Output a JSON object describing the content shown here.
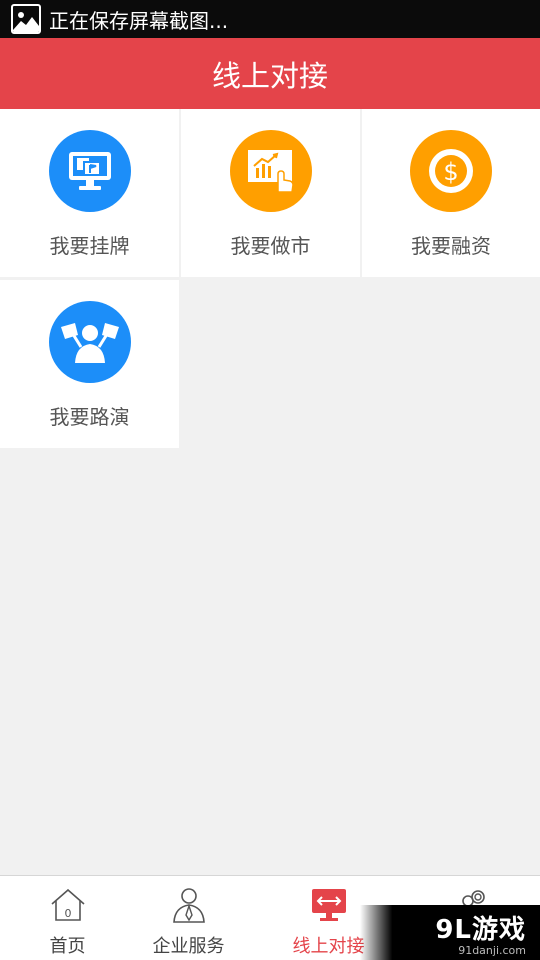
{
  "status_bar": {
    "notification_text": "正在保存屏幕截图...",
    "notification_icon": "image-icon"
  },
  "header": {
    "title": "线上对接"
  },
  "tiles": [
    {
      "label": "我要挂牌",
      "icon": "monitor-flag-icon",
      "color": "#1c8ef9"
    },
    {
      "label": "我要做市",
      "icon": "chart-touch-icon",
      "color": "#ff9f00"
    },
    {
      "label": "我要融资",
      "icon": "dollar-coin-icon",
      "color": "#ff9f00"
    },
    {
      "label": "我要路演",
      "icon": "roadshow-person-icon",
      "color": "#1c8ef9"
    }
  ],
  "bottom_nav": {
    "items": [
      {
        "label": "首页",
        "icon": "home-icon",
        "active": false
      },
      {
        "label": "企业服务",
        "icon": "business-person-icon",
        "active": false
      },
      {
        "label": "线上对接",
        "icon": "online-connect-icon",
        "active": true
      },
      {
        "label": "",
        "icon": "more-icon",
        "active": false
      }
    ]
  },
  "watermark": {
    "main": "9L游戏",
    "sub": "91danji.com"
  },
  "colors": {
    "accent": "#e4444a",
    "blue": "#1c8ef9",
    "orange": "#ff9f00",
    "background": "#f1f1f1"
  }
}
